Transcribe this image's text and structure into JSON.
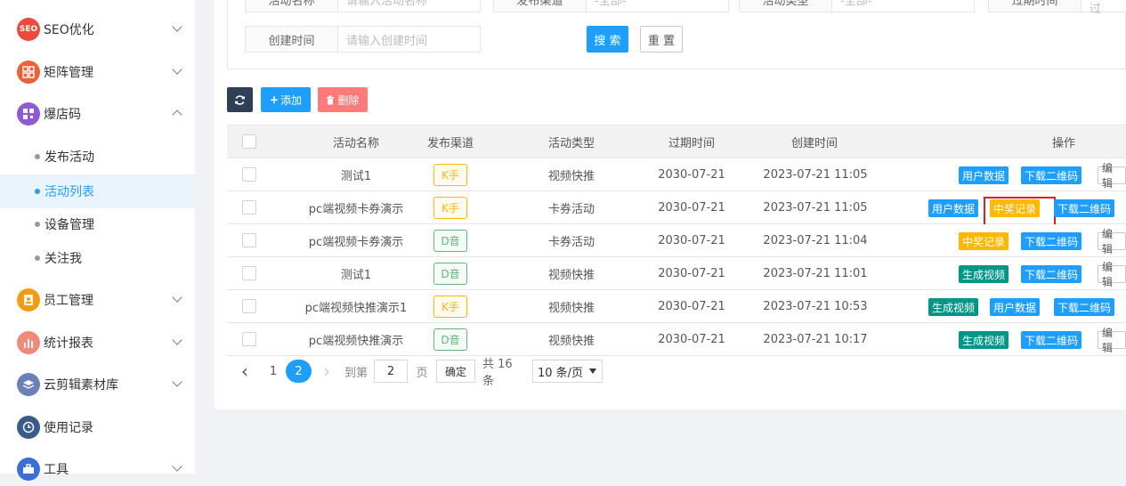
{
  "sidebar": {
    "items": [
      {
        "label": "SEO优化",
        "icon": "seo-icon",
        "icon_text": "SEO",
        "color": "#e74c3c"
      },
      {
        "label": "矩阵管理",
        "icon": "grid-icon",
        "color": "#e8633a"
      },
      {
        "label": "爆店码",
        "icon": "qrcode-icon",
        "color": "#8e5ad6"
      },
      {
        "label": "员工管理",
        "icon": "user-badge-icon",
        "color": "#f39c12"
      },
      {
        "label": "统计报表",
        "icon": "bar-chart-icon",
        "color": "#f08a7a"
      },
      {
        "label": "云剪辑素材库",
        "icon": "layers-icon",
        "color": "#6b7fb8"
      },
      {
        "label": "使用记录",
        "icon": "clock-icon",
        "color": "#3a5a8c"
      },
      {
        "label": "工具",
        "icon": "toolbox-icon",
        "color": "#3b6fd4"
      }
    ],
    "subitems": [
      {
        "label": "发布活动"
      },
      {
        "label": "活动列表"
      },
      {
        "label": "设备管理"
      },
      {
        "label": "关注我"
      }
    ]
  },
  "filters": {
    "name_label": "活动名称",
    "name_placeholder": "请输入活动名称",
    "channel_label": "发布渠道",
    "channel_value": "-全部-",
    "type_label": "活动类型",
    "type_value": "-全部-",
    "expire_label": "过期时间",
    "expire_placeholder": "请输入过",
    "created_label": "创建时间",
    "created_placeholder": "请输入创建时间",
    "search_label": "搜 索",
    "reset_label": "重 置"
  },
  "toolbar": {
    "add_label": "添加",
    "delete_label": "删除"
  },
  "table": {
    "headers": [
      "活动名称",
      "发布渠道",
      "活动类型",
      "过期时间",
      "创建时间",
      "操作"
    ],
    "rows": [
      {
        "name": "测试1",
        "channel": "K手",
        "type": "视频快推",
        "expire": "2030-07-21",
        "created": "2023-07-21 11:05",
        "actions": [
          "用户数据",
          "下载二维码",
          "编辑"
        ]
      },
      {
        "name": "pc端视频卡券演示",
        "channel": "K手",
        "type": "卡券活动",
        "expire": "2030-07-21",
        "created": "2023-07-21 11:05",
        "actions": [
          "用户数据",
          "中奖记录",
          "下载二维码"
        ]
      },
      {
        "name": "pc端视频卡券演示",
        "channel": "D音",
        "type": "卡券活动",
        "expire": "2030-07-21",
        "created": "2023-07-21 11:04",
        "actions": [
          "中奖记录",
          "下载二维码",
          "编辑"
        ]
      },
      {
        "name": "测试1",
        "channel": "D音",
        "type": "视频快推",
        "expire": "2030-07-21",
        "created": "2023-07-21 11:01",
        "actions": [
          "生成视频",
          "下载二维码",
          "编辑"
        ]
      },
      {
        "name": "pc端视频快推演示1",
        "channel": "K手",
        "type": "视频快推",
        "expire": "2030-07-21",
        "created": "2023-07-21 10:53",
        "actions": [
          "生成视频",
          "用户数据",
          "下载二维码"
        ]
      },
      {
        "name": "pc端视频快推演示",
        "channel": "D音",
        "type": "视频快推",
        "expire": "2030-07-21",
        "created": "2023-07-21 10:17",
        "actions": [
          "生成视频",
          "下载二维码",
          "编辑"
        ]
      }
    ]
  },
  "pagination": {
    "prev": "‹",
    "page1": "1",
    "page2": "2",
    "next": "›",
    "goto_label": "到第",
    "goto_value": "2",
    "page_label": "页",
    "confirm_label": "确定",
    "total_label": "共 16 条",
    "page_size": "10 条/页"
  },
  "colors": {
    "primary": "#1e9fff",
    "warn": "#ffb800",
    "green": "#009688",
    "danger": "#ff5722",
    "highlight": "#e02020"
  }
}
